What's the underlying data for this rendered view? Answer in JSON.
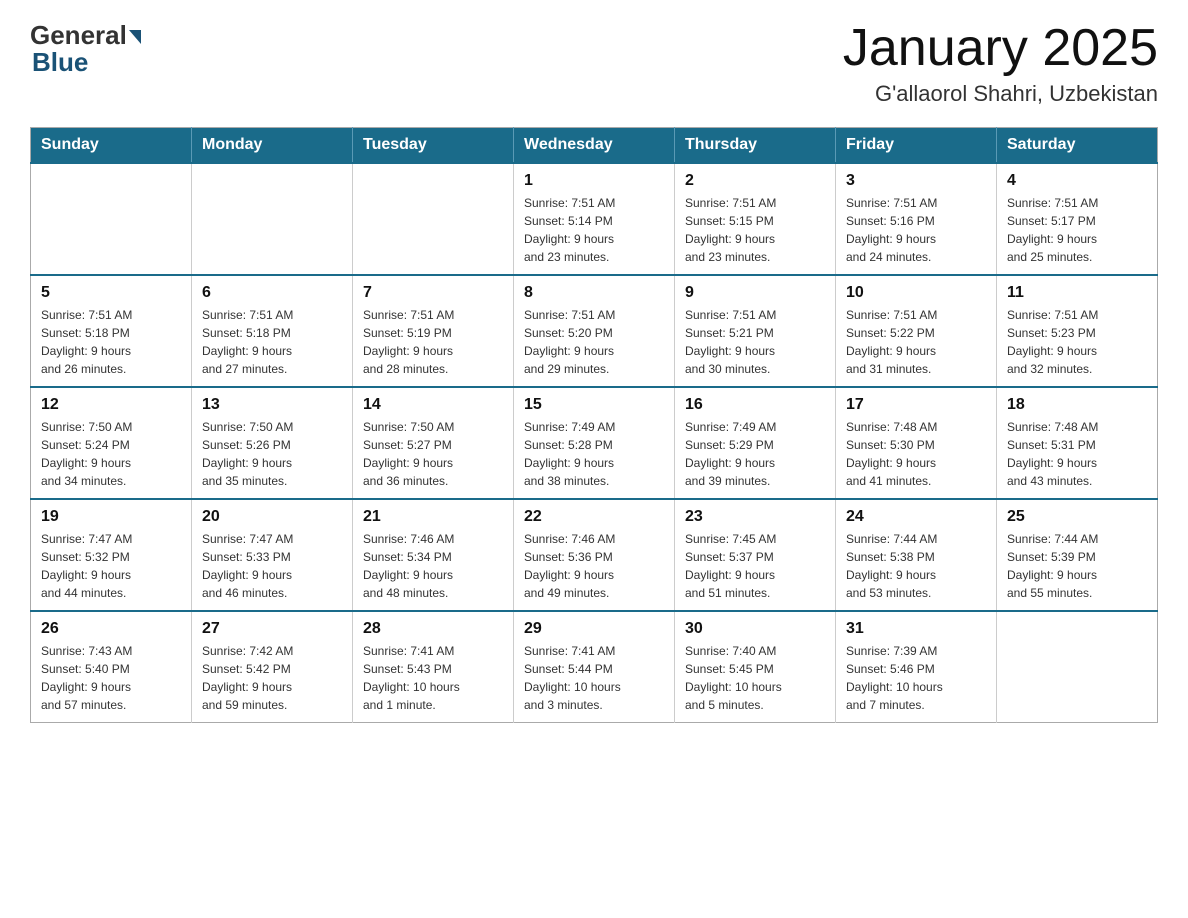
{
  "logo": {
    "general": "General",
    "blue": "Blue"
  },
  "header": {
    "title": "January 2025",
    "subtitle": "G'allaorol Shahri, Uzbekistan"
  },
  "days_of_week": [
    "Sunday",
    "Monday",
    "Tuesday",
    "Wednesday",
    "Thursday",
    "Friday",
    "Saturday"
  ],
  "weeks": [
    [
      {
        "day": "",
        "info": ""
      },
      {
        "day": "",
        "info": ""
      },
      {
        "day": "",
        "info": ""
      },
      {
        "day": "1",
        "info": "Sunrise: 7:51 AM\nSunset: 5:14 PM\nDaylight: 9 hours\nand 23 minutes."
      },
      {
        "day": "2",
        "info": "Sunrise: 7:51 AM\nSunset: 5:15 PM\nDaylight: 9 hours\nand 23 minutes."
      },
      {
        "day": "3",
        "info": "Sunrise: 7:51 AM\nSunset: 5:16 PM\nDaylight: 9 hours\nand 24 minutes."
      },
      {
        "day": "4",
        "info": "Sunrise: 7:51 AM\nSunset: 5:17 PM\nDaylight: 9 hours\nand 25 minutes."
      }
    ],
    [
      {
        "day": "5",
        "info": "Sunrise: 7:51 AM\nSunset: 5:18 PM\nDaylight: 9 hours\nand 26 minutes."
      },
      {
        "day": "6",
        "info": "Sunrise: 7:51 AM\nSunset: 5:18 PM\nDaylight: 9 hours\nand 27 minutes."
      },
      {
        "day": "7",
        "info": "Sunrise: 7:51 AM\nSunset: 5:19 PM\nDaylight: 9 hours\nand 28 minutes."
      },
      {
        "day": "8",
        "info": "Sunrise: 7:51 AM\nSunset: 5:20 PM\nDaylight: 9 hours\nand 29 minutes."
      },
      {
        "day": "9",
        "info": "Sunrise: 7:51 AM\nSunset: 5:21 PM\nDaylight: 9 hours\nand 30 minutes."
      },
      {
        "day": "10",
        "info": "Sunrise: 7:51 AM\nSunset: 5:22 PM\nDaylight: 9 hours\nand 31 minutes."
      },
      {
        "day": "11",
        "info": "Sunrise: 7:51 AM\nSunset: 5:23 PM\nDaylight: 9 hours\nand 32 minutes."
      }
    ],
    [
      {
        "day": "12",
        "info": "Sunrise: 7:50 AM\nSunset: 5:24 PM\nDaylight: 9 hours\nand 34 minutes."
      },
      {
        "day": "13",
        "info": "Sunrise: 7:50 AM\nSunset: 5:26 PM\nDaylight: 9 hours\nand 35 minutes."
      },
      {
        "day": "14",
        "info": "Sunrise: 7:50 AM\nSunset: 5:27 PM\nDaylight: 9 hours\nand 36 minutes."
      },
      {
        "day": "15",
        "info": "Sunrise: 7:49 AM\nSunset: 5:28 PM\nDaylight: 9 hours\nand 38 minutes."
      },
      {
        "day": "16",
        "info": "Sunrise: 7:49 AM\nSunset: 5:29 PM\nDaylight: 9 hours\nand 39 minutes."
      },
      {
        "day": "17",
        "info": "Sunrise: 7:48 AM\nSunset: 5:30 PM\nDaylight: 9 hours\nand 41 minutes."
      },
      {
        "day": "18",
        "info": "Sunrise: 7:48 AM\nSunset: 5:31 PM\nDaylight: 9 hours\nand 43 minutes."
      }
    ],
    [
      {
        "day": "19",
        "info": "Sunrise: 7:47 AM\nSunset: 5:32 PM\nDaylight: 9 hours\nand 44 minutes."
      },
      {
        "day": "20",
        "info": "Sunrise: 7:47 AM\nSunset: 5:33 PM\nDaylight: 9 hours\nand 46 minutes."
      },
      {
        "day": "21",
        "info": "Sunrise: 7:46 AM\nSunset: 5:34 PM\nDaylight: 9 hours\nand 48 minutes."
      },
      {
        "day": "22",
        "info": "Sunrise: 7:46 AM\nSunset: 5:36 PM\nDaylight: 9 hours\nand 49 minutes."
      },
      {
        "day": "23",
        "info": "Sunrise: 7:45 AM\nSunset: 5:37 PM\nDaylight: 9 hours\nand 51 minutes."
      },
      {
        "day": "24",
        "info": "Sunrise: 7:44 AM\nSunset: 5:38 PM\nDaylight: 9 hours\nand 53 minutes."
      },
      {
        "day": "25",
        "info": "Sunrise: 7:44 AM\nSunset: 5:39 PM\nDaylight: 9 hours\nand 55 minutes."
      }
    ],
    [
      {
        "day": "26",
        "info": "Sunrise: 7:43 AM\nSunset: 5:40 PM\nDaylight: 9 hours\nand 57 minutes."
      },
      {
        "day": "27",
        "info": "Sunrise: 7:42 AM\nSunset: 5:42 PM\nDaylight: 9 hours\nand 59 minutes."
      },
      {
        "day": "28",
        "info": "Sunrise: 7:41 AM\nSunset: 5:43 PM\nDaylight: 10 hours\nand 1 minute."
      },
      {
        "day": "29",
        "info": "Sunrise: 7:41 AM\nSunset: 5:44 PM\nDaylight: 10 hours\nand 3 minutes."
      },
      {
        "day": "30",
        "info": "Sunrise: 7:40 AM\nSunset: 5:45 PM\nDaylight: 10 hours\nand 5 minutes."
      },
      {
        "day": "31",
        "info": "Sunrise: 7:39 AM\nSunset: 5:46 PM\nDaylight: 10 hours\nand 7 minutes."
      },
      {
        "day": "",
        "info": ""
      }
    ]
  ]
}
